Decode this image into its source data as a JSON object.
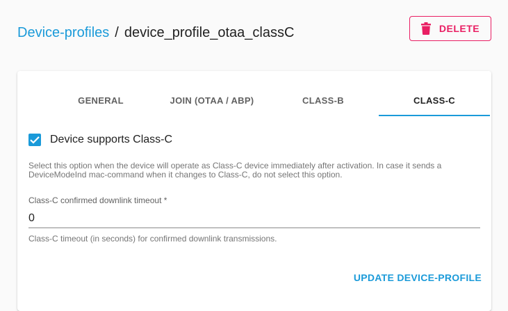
{
  "breadcrumb": {
    "parent": "Device-profiles",
    "separator": "/",
    "current": "device_profile_otaa_classC"
  },
  "actions": {
    "delete_label": "DELETE",
    "delete_icon": "trash-icon"
  },
  "tabs": [
    {
      "label": "GENERAL"
    },
    {
      "label": "JOIN (OTAA / ABP)"
    },
    {
      "label": "CLASS-B"
    },
    {
      "label": "CLASS-C",
      "active": true
    }
  ],
  "classc": {
    "supports_label": "Device supports Class-C",
    "supports_checked": true,
    "supports_help": "Select this option when the device will operate as Class-C device immediately after activation. In case it sends a DeviceModeInd mac-command when it changes to Class-C, do not select this option.",
    "timeout_label": "Class-C confirmed downlink timeout *",
    "timeout_value": "0",
    "timeout_help": "Class-C timeout (in seconds) for confirmed downlink transmissions."
  },
  "footer": {
    "update_label": "UPDATE DEVICE-PROFILE"
  },
  "colors": {
    "accent": "#1a9ad9",
    "danger": "#e91e63"
  }
}
